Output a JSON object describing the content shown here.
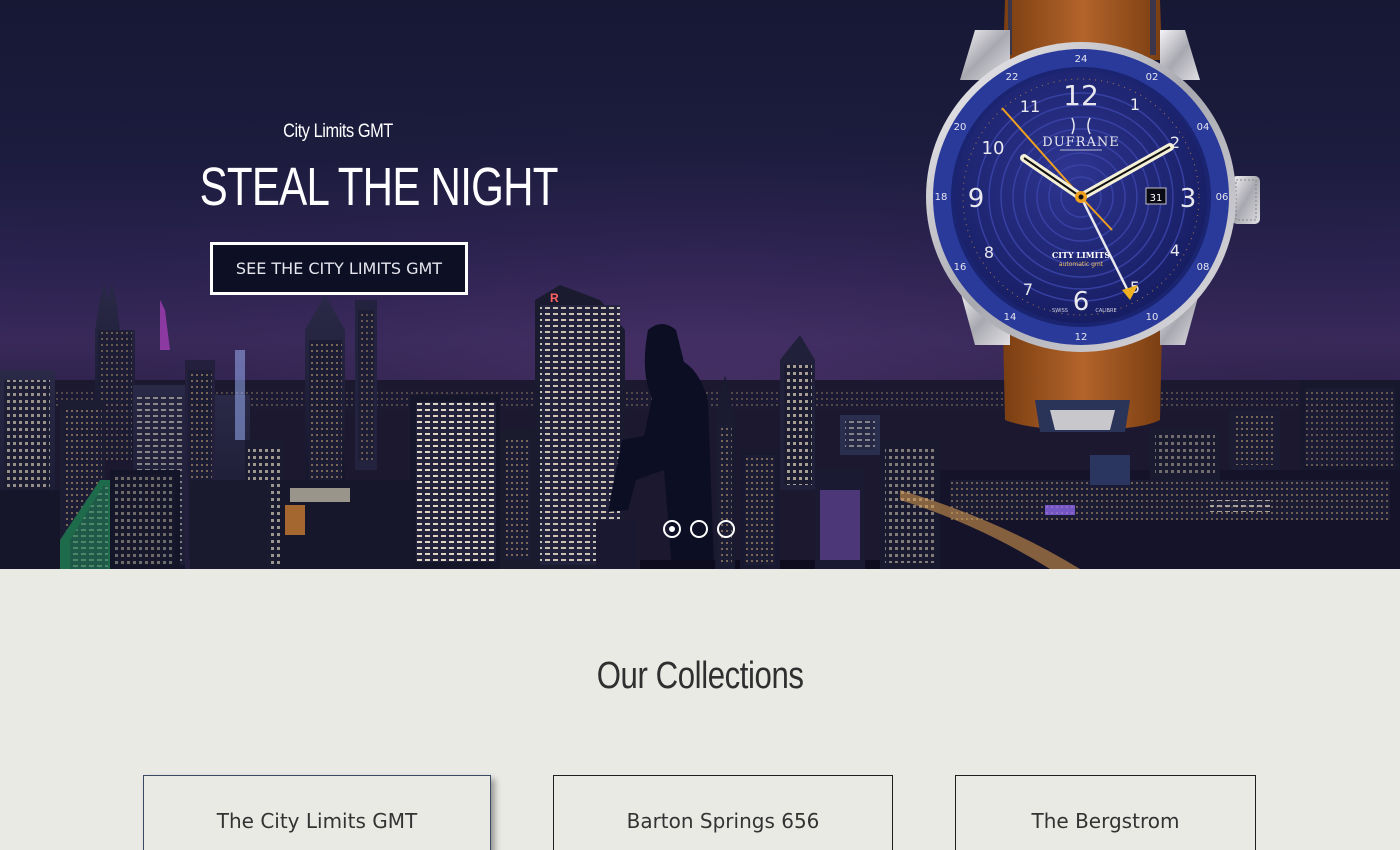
{
  "hero": {
    "subtitle": "City Limits GMT",
    "title": "STEAL THE NIGHT",
    "cta_label": "SEE THE CITY LIMITS GMT",
    "watch": {
      "brand": "DUFRANE",
      "model": "CITY LIMITS",
      "sub": "automatic gmt",
      "date": "31",
      "swiss": "SWISS",
      "calibre": "CALIBRE",
      "hour_numerals": [
        "12",
        "1",
        "2",
        "3",
        "4",
        "5",
        "6",
        "7",
        "8",
        "9",
        "10",
        "11"
      ],
      "bezel_numerals": [
        "24",
        "02",
        "04",
        "06",
        "08",
        "10",
        "12",
        "14",
        "16",
        "18",
        "20",
        "22"
      ]
    },
    "slider": {
      "count": 3,
      "active_index": 0
    }
  },
  "collections": {
    "heading": "Our Collections",
    "items": [
      {
        "label": "The City Limits GMT"
      },
      {
        "label": "Barton Springs 656"
      },
      {
        "label": "The Bergstrom"
      }
    ]
  },
  "colors": {
    "hero_sky": "#1c1c3e",
    "cta_background": "#0d0f24",
    "page_background": "#eaeae5",
    "watch_dial": "#1f2470",
    "watch_bezel": "#2a3a9a",
    "strap": "#9a5420",
    "gmt_hand": "#f0a020"
  }
}
